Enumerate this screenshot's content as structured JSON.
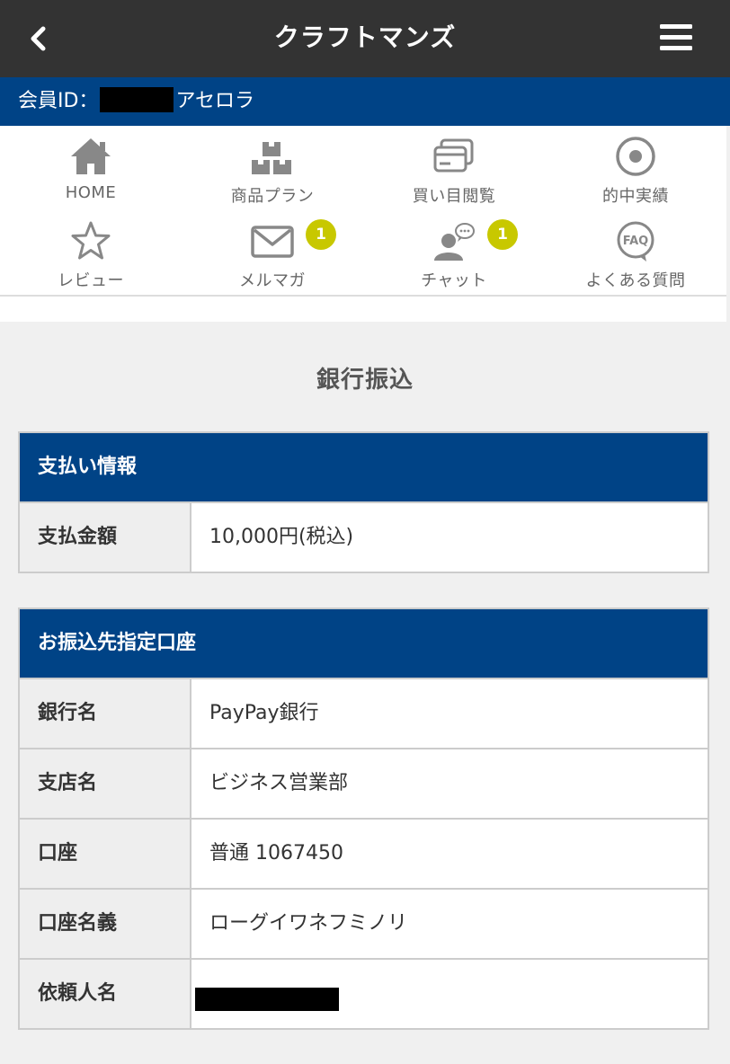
{
  "header": {
    "title": "クラフトマンズ",
    "back_icon": "chevron-left-icon",
    "menu_icon": "hamburger-menu-icon"
  },
  "member": {
    "prefix": "会員ID：",
    "name_suffix": "アセロラ"
  },
  "nav": {
    "items": [
      {
        "label": "HOME",
        "icon": "home-icon"
      },
      {
        "label": "商品プラン",
        "icon": "boxes-icon"
      },
      {
        "label": "買い目閲覧",
        "icon": "cards-icon"
      },
      {
        "label": "的中実績",
        "icon": "target-icon"
      },
      {
        "label": "レビュー",
        "icon": "star-icon"
      },
      {
        "label": "メルマガ",
        "icon": "mail-icon",
        "badge": "1"
      },
      {
        "label": "チャット",
        "icon": "chat-user-icon",
        "badge": "1"
      },
      {
        "label": "よくある質問",
        "icon": "faq-icon"
      }
    ]
  },
  "page": {
    "title": "銀行振込"
  },
  "payment": {
    "heading": "支払い情報",
    "rows": [
      {
        "label": "支払金額",
        "value": "10,000円(税込)"
      }
    ]
  },
  "account": {
    "heading": "お振込先指定口座",
    "rows": [
      {
        "label": "銀行名",
        "value": "PayPay銀行"
      },
      {
        "label": "支店名",
        "value": "ビジネス営業部"
      },
      {
        "label": "口座",
        "value": "普通 1067450"
      },
      {
        "label": "口座名義",
        "value": "ローグイワネフミノリ"
      },
      {
        "label": "依頼人名",
        "value": ""
      }
    ]
  },
  "colors": {
    "header_bg": "#333333",
    "brand_blue": "#004386",
    "badge": "#c8c800"
  }
}
